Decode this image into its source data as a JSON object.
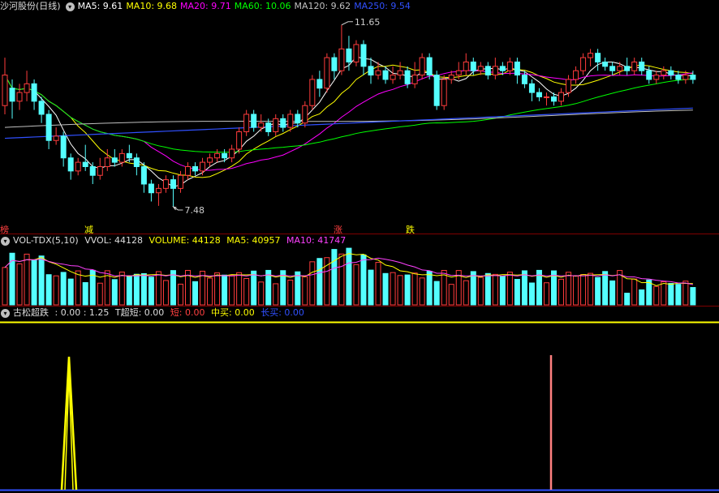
{
  "main_panel": {
    "title": "沙河股份(日线)",
    "ma": [
      {
        "label": "MA5: 9.61",
        "color": "#ffffff"
      },
      {
        "label": "MA10: 9.68",
        "color": "#ffff00"
      },
      {
        "label": "MA20: 9.71",
        "color": "#ff00ff"
      },
      {
        "label": "MA60: 10.06",
        "color": "#00ff00"
      },
      {
        "label": "MA120: 9.62",
        "color": "#c0c0c0"
      },
      {
        "label": "MA250: 9.54",
        "color": "#3050ff"
      }
    ],
    "high_label": "11.65",
    "low_label": "7.48",
    "signals": [
      {
        "text": "榜",
        "color": "#ff4040"
      },
      {
        "text": "减",
        "color": "#ffff00"
      },
      {
        "text": "涨",
        "color": "#ff4040"
      },
      {
        "text": "跌",
        "color": "#ffff00"
      }
    ]
  },
  "volume_panel": {
    "name": "VOL-TDX(5,10)",
    "vvol": "VVOL: 44128",
    "volume": "VOLUME: 44128",
    "ma5": "MA5: 40957",
    "ma10": "MA10: 41747"
  },
  "indicator_panel": {
    "name": "古松超跌",
    "values": ": 0.00 : 1.25",
    "t_short": "T超短: 0.00",
    "short": "短: 0.00",
    "mid": "中买: 0.00",
    "long": "长买: 0.00"
  },
  "colors": {
    "up": "#ff3c3c",
    "down": "#54ffff",
    "yellow": "#ffff00",
    "pink": "#ff8080",
    "blue": "#3050ff"
  },
  "chart_data": {
    "type": "candlestick",
    "high_marker": 11.65,
    "low_marker": 7.48,
    "candles": [
      [
        9.8,
        10.5,
        9.6,
        10.9
      ],
      [
        10.2,
        9.9,
        9.5,
        10.4
      ],
      [
        9.9,
        10.1,
        9.7,
        10.3
      ],
      [
        10.1,
        10.3,
        9.9,
        10.6
      ],
      [
        10.3,
        9.9,
        9.7,
        10.4
      ],
      [
        9.9,
        9.6,
        9.4,
        10.0
      ],
      [
        9.6,
        9.0,
        8.8,
        9.7
      ],
      [
        9.0,
        9.1,
        8.9,
        9.3
      ],
      [
        9.1,
        8.6,
        8.4,
        9.2
      ],
      [
        8.6,
        8.3,
        8.1,
        8.7
      ],
      [
        8.3,
        8.5,
        8.2,
        8.6
      ],
      [
        8.5,
        8.4,
        8.3,
        8.9
      ],
      [
        8.4,
        8.2,
        8.0,
        8.5
      ],
      [
        8.2,
        8.4,
        8.1,
        8.6
      ],
      [
        8.4,
        8.6,
        8.3,
        8.8
      ],
      [
        8.6,
        8.5,
        8.4,
        8.8
      ],
      [
        8.5,
        8.7,
        8.4,
        8.8
      ],
      [
        8.7,
        8.6,
        8.5,
        8.9
      ],
      [
        8.6,
        8.4,
        8.2,
        8.7
      ],
      [
        8.4,
        8.0,
        7.8,
        8.5
      ],
      [
        8.0,
        7.8,
        7.6,
        8.1
      ],
      [
        7.8,
        7.9,
        7.5,
        8.0
      ],
      [
        7.9,
        8.1,
        7.8,
        8.2
      ],
      [
        8.1,
        7.9,
        7.48,
        8.2
      ],
      [
        7.9,
        8.2,
        7.8,
        8.3
      ],
      [
        8.2,
        8.4,
        8.1,
        8.5
      ],
      [
        8.4,
        8.3,
        8.2,
        8.5
      ],
      [
        8.3,
        8.5,
        8.2,
        8.6
      ],
      [
        8.5,
        8.6,
        8.4,
        8.7
      ],
      [
        8.6,
        8.7,
        8.5,
        8.8
      ],
      [
        8.7,
        8.6,
        8.5,
        8.8
      ],
      [
        8.6,
        8.8,
        8.5,
        8.9
      ],
      [
        8.8,
        9.2,
        8.7,
        9.3
      ],
      [
        9.2,
        9.6,
        9.1,
        9.7
      ],
      [
        9.6,
        9.3,
        9.2,
        9.7
      ],
      [
        9.3,
        9.4,
        9.2,
        9.6
      ],
      [
        9.4,
        9.2,
        9.1,
        9.5
      ],
      [
        9.2,
        9.5,
        9.1,
        9.6
      ],
      [
        9.5,
        9.3,
        9.2,
        9.6
      ],
      [
        9.3,
        9.6,
        9.2,
        9.7
      ],
      [
        9.6,
        9.4,
        9.3,
        9.7
      ],
      [
        9.4,
        9.8,
        9.3,
        9.9
      ],
      [
        9.8,
        10.4,
        9.7,
        10.5
      ],
      [
        10.4,
        10.2,
        10.0,
        10.6
      ],
      [
        10.2,
        10.9,
        10.1,
        11.0
      ],
      [
        10.9,
        10.6,
        10.4,
        11.0
      ],
      [
        10.6,
        11.1,
        10.5,
        11.65
      ],
      [
        11.1,
        10.8,
        10.6,
        11.4
      ],
      [
        10.8,
        11.2,
        10.7,
        11.3
      ],
      [
        11.2,
        10.7,
        10.5,
        11.3
      ],
      [
        10.7,
        10.5,
        10.3,
        10.9
      ],
      [
        10.5,
        10.6,
        10.4,
        10.8
      ],
      [
        10.6,
        10.4,
        10.3,
        10.7
      ],
      [
        10.4,
        10.5,
        10.3,
        10.7
      ],
      [
        10.5,
        10.6,
        10.4,
        10.8
      ],
      [
        10.6,
        10.3,
        10.2,
        10.7
      ],
      [
        10.3,
        10.5,
        10.2,
        10.8
      ],
      [
        10.5,
        10.9,
        10.4,
        11.0
      ],
      [
        10.9,
        10.5,
        10.4,
        11.0
      ],
      [
        10.5,
        9.8,
        9.7,
        10.6
      ],
      [
        9.8,
        10.4,
        9.7,
        10.5
      ],
      [
        10.4,
        10.5,
        10.3,
        10.6
      ],
      [
        10.5,
        10.6,
        10.4,
        10.8
      ],
      [
        10.6,
        10.8,
        10.5,
        11.0
      ],
      [
        10.8,
        10.6,
        10.5,
        10.9
      ],
      [
        10.6,
        10.7,
        10.5,
        10.8
      ],
      [
        10.7,
        10.5,
        10.4,
        10.8
      ],
      [
        10.5,
        10.7,
        10.4,
        10.9
      ],
      [
        10.7,
        10.6,
        10.5,
        10.8
      ],
      [
        10.6,
        10.8,
        10.5,
        10.9
      ],
      [
        10.8,
        10.5,
        10.3,
        10.9
      ],
      [
        10.5,
        10.3,
        10.2,
        10.6
      ],
      [
        10.3,
        10.1,
        9.9,
        10.4
      ],
      [
        10.1,
        10.0,
        9.9,
        10.2
      ],
      [
        10.0,
        10.0,
        9.8,
        10.1
      ],
      [
        10.0,
        9.9,
        9.8,
        10.1
      ],
      [
        9.9,
        10.1,
        9.8,
        10.2
      ],
      [
        10.1,
        10.4,
        10.0,
        10.5
      ],
      [
        10.4,
        10.6,
        10.3,
        10.7
      ],
      [
        10.6,
        10.9,
        10.5,
        11.0
      ],
      [
        10.9,
        11.0,
        10.7,
        11.1
      ],
      [
        11.0,
        10.8,
        10.6,
        11.1
      ],
      [
        10.8,
        10.7,
        10.6,
        10.9
      ],
      [
        10.7,
        10.6,
        10.5,
        10.8
      ],
      [
        10.6,
        10.7,
        10.5,
        10.8
      ],
      [
        10.7,
        10.6,
        10.5,
        10.9
      ],
      [
        10.6,
        10.8,
        10.5,
        10.9
      ],
      [
        10.8,
        10.6,
        10.5,
        10.9
      ],
      [
        10.6,
        10.4,
        10.3,
        10.7
      ],
      [
        10.4,
        10.5,
        10.3,
        10.6
      ],
      [
        10.5,
        10.6,
        10.4,
        10.7
      ],
      [
        10.6,
        10.5,
        10.4,
        10.7
      ],
      [
        10.5,
        10.4,
        10.3,
        10.6
      ],
      [
        10.4,
        10.5,
        10.3,
        10.6
      ],
      [
        10.5,
        10.4,
        10.3,
        10.6
      ]
    ]
  }
}
